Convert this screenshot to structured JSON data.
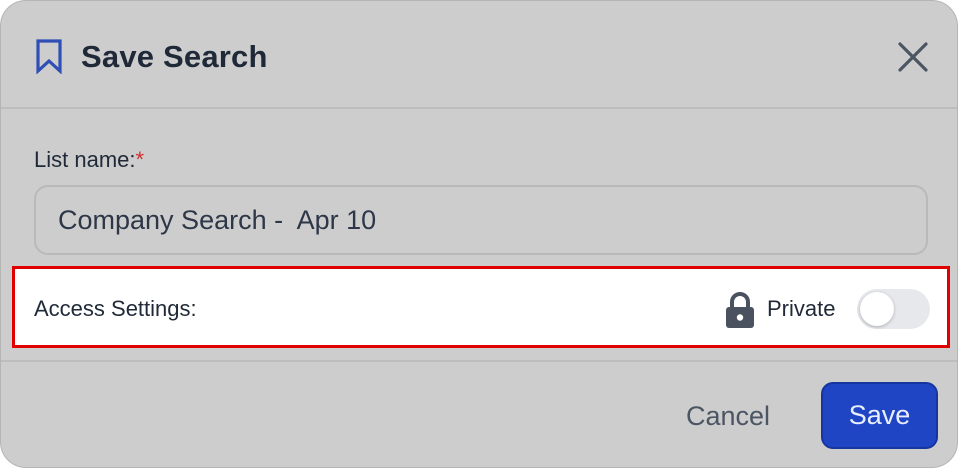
{
  "dialog": {
    "title": "Save Search",
    "header_icon": "bookmark-icon",
    "close_icon": "close-icon"
  },
  "form": {
    "list_name_label": "List name:",
    "required_marker": "*",
    "list_name_value": "Company Search -  Apr 10",
    "access_settings_label": "Access Settings:",
    "privacy_icon": "lock-icon",
    "privacy_label": "Private",
    "private_toggle_on": false
  },
  "footer": {
    "cancel_label": "Cancel",
    "save_label": "Save"
  },
  "colors": {
    "brand_blue": "#1f45c4",
    "icon_blue": "#2f4fb6",
    "required_red": "#d32f2f",
    "highlight_red": "#e10000"
  }
}
